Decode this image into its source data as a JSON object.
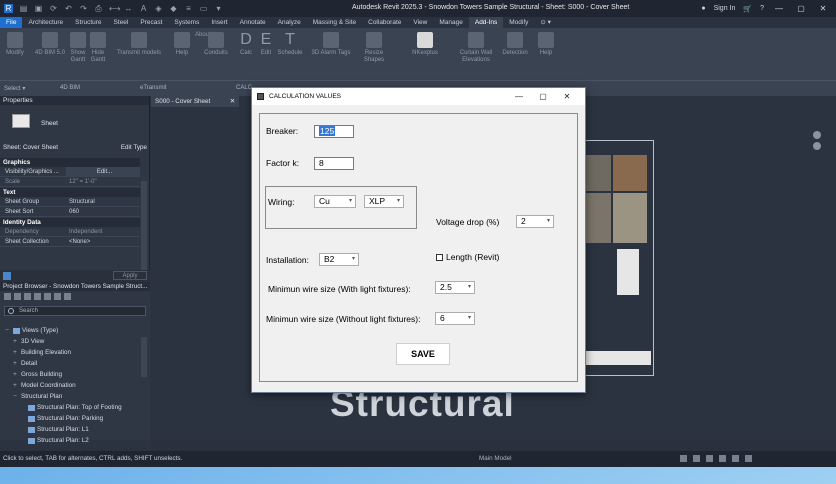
{
  "titlebar": {
    "app_title": "Autodesk Revit 2025.3 - Snowdon Towers Sample Structural - Sheet: S000 - Cover Sheet",
    "sign_in": "Sign In"
  },
  "ribbon": {
    "tabs": [
      {
        "label": "File"
      },
      {
        "label": "Architecture"
      },
      {
        "label": "Structure"
      },
      {
        "label": "Steel"
      },
      {
        "label": "Precast"
      },
      {
        "label": "Systems"
      },
      {
        "label": "Insert"
      },
      {
        "label": "Annotate"
      },
      {
        "label": "Analyze"
      },
      {
        "label": "Massing & Site"
      },
      {
        "label": "Collaborate"
      },
      {
        "label": "View"
      },
      {
        "label": "Manage"
      },
      {
        "label": "Add-Ins"
      },
      {
        "label": "Modify"
      }
    ],
    "tools": [
      {
        "label": "Modify"
      },
      {
        "label": "4D BIM 5.0"
      },
      {
        "label": "Show Gantt"
      },
      {
        "label": "Hide Gantt"
      },
      {
        "label": "Transmit models"
      },
      {
        "label": "Help"
      },
      {
        "label": "About"
      },
      {
        "label": "Conduits"
      },
      {
        "label": "Calc"
      },
      {
        "label": "Edit"
      },
      {
        "label": "Schedule"
      },
      {
        "label": "3D Alarm Tags"
      },
      {
        "label": "Resize Shapes"
      },
      {
        "label": "NKexplus"
      },
      {
        "label": "Curtain Wall Elevations"
      },
      {
        "label": "Detection"
      },
      {
        "label": "Help"
      }
    ],
    "panels": {
      "select": "Select ▾",
      "bim4d": "4D BIM",
      "etransmit": "eTransmit",
      "calc": "CALC"
    }
  },
  "properties": {
    "header": "Properties",
    "type_name": "Sheet",
    "filter": "Sheet: Cover Sheet",
    "edit_type": "Edit Type",
    "graphics_cat": "Graphics",
    "visibility_key": "Visibility/Graphics ...",
    "visibility_val": "Edit...",
    "scale_key": "Scale",
    "scale_val": "12\" = 1'-0\"",
    "text_cat": "Text",
    "group_key": "Sheet Group",
    "group_val": "Structural",
    "sort_key": "Sheet Sort",
    "sort_val": "060",
    "identity_cat": "Identity Data",
    "dependency_key": "Dependency",
    "dependency_val": "Independent",
    "collection_key": "Sheet Collection",
    "collection_val": "<None>",
    "apply": "Apply"
  },
  "browser": {
    "header": "Project Browser - Snowdon Towers Sample Struct...",
    "search_placeholder": "Search",
    "items": [
      {
        "toggle": "−",
        "label": "Views (Type)"
      },
      {
        "toggle": "+",
        "label": "3D View"
      },
      {
        "toggle": "+",
        "label": "Building Elevation"
      },
      {
        "toggle": "+",
        "label": "Detail"
      },
      {
        "toggle": "+",
        "label": "Gross Building"
      },
      {
        "toggle": "+",
        "label": "Model Coordination"
      },
      {
        "toggle": "−",
        "label": "Structural Plan"
      },
      {
        "toggle": "",
        "label": "Structural Plan: Top of Footing"
      },
      {
        "toggle": "",
        "label": "Structural Plan: Parking"
      },
      {
        "toggle": "",
        "label": "Structural Plan: L1"
      },
      {
        "toggle": "",
        "label": "Structural Plan: L2"
      }
    ]
  },
  "view": {
    "tab_label": "S000 - Cover Sheet",
    "big_text": "Structural"
  },
  "status": {
    "hint": "Click to select, TAB for alternates, CTRL adds, SHIFT unselects.",
    "model": "Main Model"
  },
  "dialog": {
    "title": "CALCULATION VALUES",
    "breaker_label": "Breaker:",
    "breaker_value": "125",
    "factor_label": "Factor k:",
    "factor_value": "8",
    "wiring_label": "Wiring:",
    "wiring_material": "Cu",
    "wiring_insulation": "XLP",
    "voltage_label": "Voltage drop (%)",
    "voltage_value": "2",
    "installation_label": "Installation:",
    "installation_value": "B2",
    "length_label": "Length (Revit)",
    "min_light_label": "Minimun wire size (With light fixtures):",
    "min_light_value": "2.5",
    "min_nolight_label": "Minimun wire size (Without light fixtures):",
    "min_nolight_value": "6",
    "save": "SAVE"
  }
}
